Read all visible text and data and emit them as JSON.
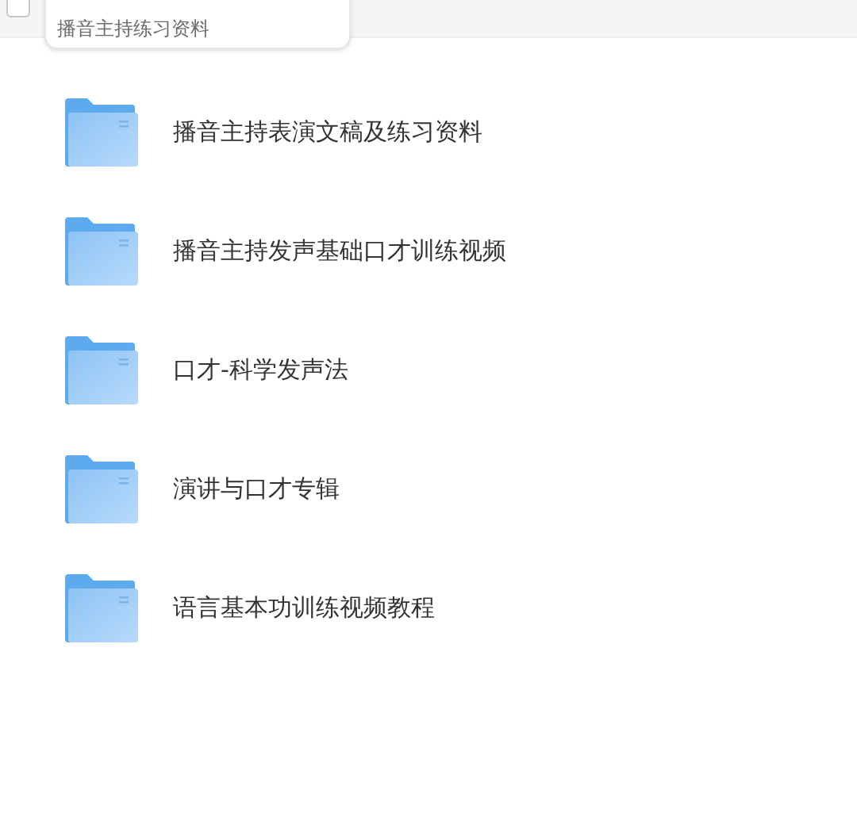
{
  "header": {
    "select_all": {
      "checked": false
    }
  },
  "tooltip": {
    "text": "播音主持练习资料"
  },
  "folders": [
    {
      "name": "播音主持表演文稿及练习资料"
    },
    {
      "name": "播音主持发声基础口才训练视频"
    },
    {
      "name": "口才-科学发声法"
    },
    {
      "name": "演讲与口才专辑"
    },
    {
      "name": "语言基本功训练视频教程"
    }
  ]
}
